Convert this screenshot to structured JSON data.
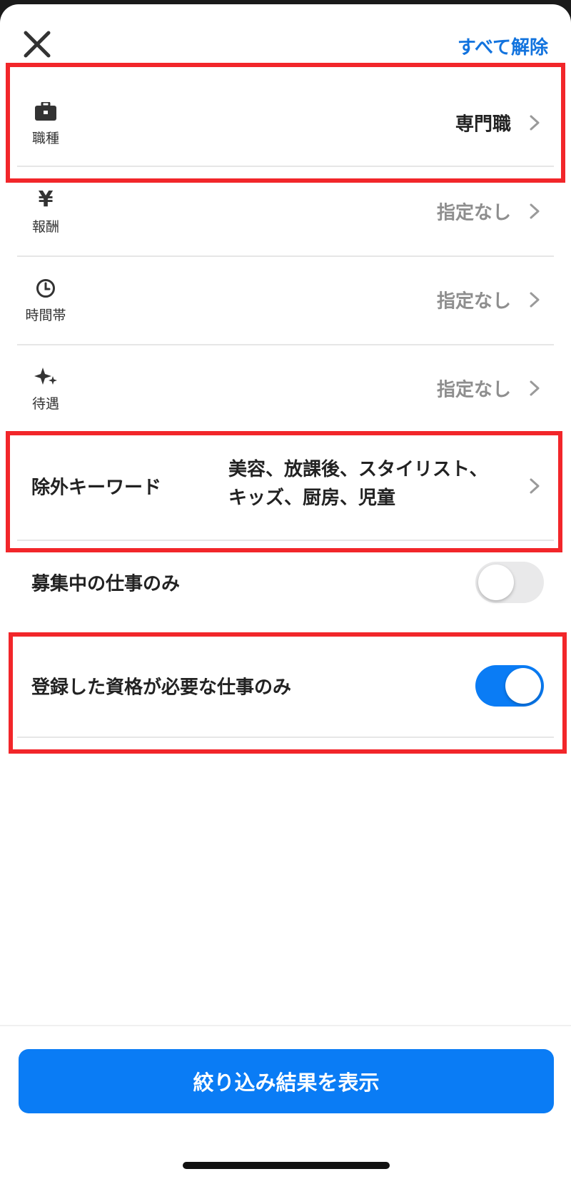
{
  "header": {
    "clear_all_label": "すべて解除"
  },
  "filters": [
    {
      "icon": "briefcase-icon",
      "label": "職種",
      "value": "専門職"
    },
    {
      "icon": "yen-icon",
      "label": "報酬",
      "value": "指定なし"
    },
    {
      "icon": "clock-icon",
      "label": "時間帯",
      "value": "指定なし"
    },
    {
      "icon": "sparkle-icon",
      "label": "待遇",
      "value": "指定なし"
    }
  ],
  "exclude": {
    "label": "除外キーワード",
    "keywords_line1": "美容、放課後、スタイリスト、",
    "keywords_line2": "キッズ、厨房、児童"
  },
  "toggles": [
    {
      "label": "募集中の仕事のみ",
      "on": false
    },
    {
      "label": "登録した資格が必要な仕事のみ",
      "on": true
    }
  ],
  "submit_label": "絞り込み結果を表示",
  "colors": {
    "accent": "#0a7cf5",
    "highlight": "#f2262a",
    "link": "#1273de"
  }
}
